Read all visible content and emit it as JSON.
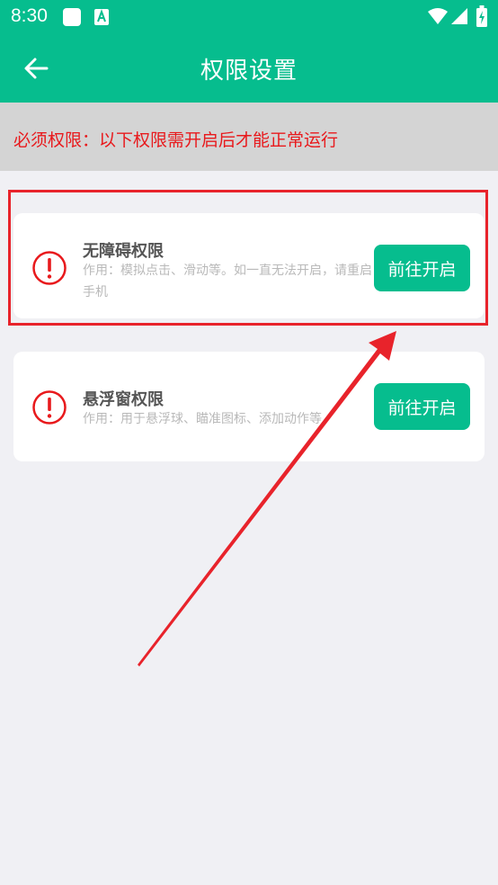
{
  "status_bar": {
    "time": "8:30",
    "icons": [
      "square-notification-icon",
      "a-notification-icon",
      "wifi-icon",
      "signal-icon",
      "battery-charging-icon"
    ]
  },
  "app_bar": {
    "title": "权限设置",
    "back_icon": "arrow-left-icon"
  },
  "notice": {
    "text": "必须权限：以下权限需开启后才能正常运行",
    "color": "#e8191c"
  },
  "permissions": [
    {
      "title": "无障碍权限",
      "description": "作用：模拟点击、滑动等。如一直无法开启，请重启手机",
      "button": "前往开启",
      "icon": "exclamation-circle-icon"
    },
    {
      "title": "悬浮窗权限",
      "description": "作用：用于悬浮球、瞄准图标、添加动作等",
      "button": "前往开启",
      "icon": "exclamation-circle-icon"
    }
  ],
  "colors": {
    "brand": "#06bd8e",
    "warning": "#e8191c",
    "annotation": "#e8232b",
    "background": "#f0f0f4"
  }
}
